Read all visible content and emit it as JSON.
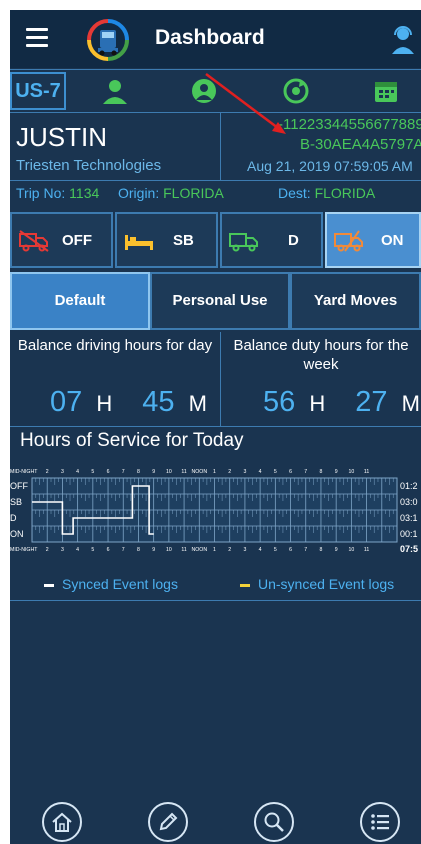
{
  "header": {
    "title": "Dashboard"
  },
  "status_bar": {
    "rule": "US-7"
  },
  "driver": {
    "name": "JUSTIN",
    "company": "Triesten Technologies",
    "device_line1": "-11223344556677889",
    "device_line2": "B-30AEA4A5797A",
    "datetime": "Aug 21, 2019 07:59:05 AM"
  },
  "trip": {
    "trip_label": "Trip No:",
    "trip_value": "1134",
    "origin_label": "Origin:",
    "origin_value": "FLORIDA",
    "dest_label": "Dest:",
    "dest_value": "FLORIDA"
  },
  "duty_status": [
    {
      "label": "OFF",
      "selected": false
    },
    {
      "label": "SB",
      "selected": false
    },
    {
      "label": "D",
      "selected": false
    },
    {
      "label": "ON",
      "selected": true
    }
  ],
  "modes": [
    {
      "label": "Default",
      "active": true
    },
    {
      "label": "Personal Use",
      "active": false
    },
    {
      "label": "Yard Moves",
      "active": false
    }
  ],
  "balance": {
    "driving_label": "Balance driving hours for day",
    "driving_hours": "07",
    "driving_minutes": "45",
    "duty_label": "Balance duty hours for the week",
    "duty_hours": "56",
    "duty_minutes": "27",
    "unit_h": "H",
    "unit_m": "M"
  },
  "hos": {
    "title": "Hours of Service for Today",
    "rows": [
      "OFF",
      "SB",
      "D",
      "ON"
    ],
    "hour_labels": [
      "MID-NIGHT",
      "2",
      "3",
      "4",
      "5",
      "6",
      "7",
      "8",
      "9",
      "10",
      "11",
      "NOON",
      "1",
      "2",
      "3",
      "4",
      "5",
      "6",
      "7",
      "8",
      "9",
      "10",
      "11"
    ],
    "row_totals": [
      "01:2",
      "03:0",
      "03:1",
      "00:1"
    ],
    "total": "07:5",
    "legend_synced": "Synced Event logs",
    "legend_unsynced": "Un-synced Event logs"
  },
  "colors": {
    "accent_blue": "#4db1f0",
    "green": "#49c75a",
    "background": "#1a3450",
    "synced": "#ffffff",
    "unsynced": "#f2d13a",
    "annotation_arrow": "#e02020"
  },
  "nav": [
    {
      "name": "home-icon"
    },
    {
      "name": "edit-icon"
    },
    {
      "name": "search-icon"
    },
    {
      "name": "list-icon"
    }
  ]
}
